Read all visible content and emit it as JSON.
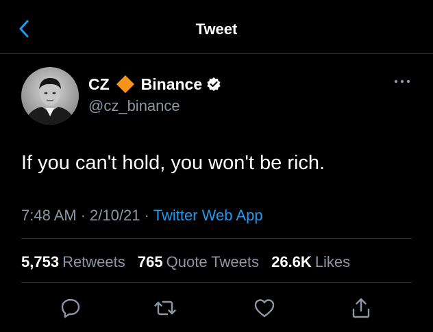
{
  "header": {
    "title": "Tweet",
    "back_icon": "chevron-left-icon"
  },
  "author": {
    "name": "CZ",
    "affiliation": "Binance",
    "handle": "@cz_binance",
    "badge_icon": "orange-diamond-icon",
    "verified_icon": "verified-badge-icon"
  },
  "tweet": {
    "text": "If you can't hold, you won't be rich.",
    "time": "7:48 AM",
    "date": "2/10/21",
    "separator": "·",
    "source": "Twitter Web App"
  },
  "stats": {
    "retweets_count": "5,753",
    "retweets_label": "Retweets",
    "quotes_count": "765",
    "quotes_label": "Quote Tweets",
    "likes_count": "26.6K",
    "likes_label": "Likes"
  },
  "actions": [
    "reply-icon",
    "retweet-icon",
    "like-icon",
    "share-icon"
  ],
  "colors": {
    "background": "#000000",
    "text_primary": "#ffffff",
    "text_secondary": "#8b98a5",
    "accent": "#1d9bf0",
    "diamond": "#f7931a",
    "divider": "#2f3336"
  }
}
